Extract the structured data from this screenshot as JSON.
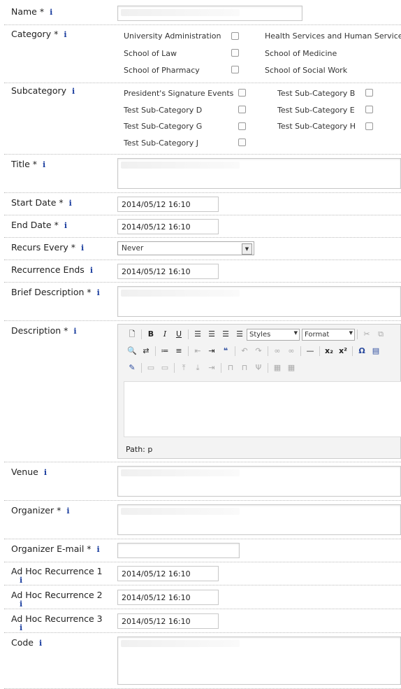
{
  "fields": {
    "name": {
      "label": "Name *",
      "info": "i"
    },
    "category": {
      "label": "Category *",
      "info": "i",
      "options": [
        "University Administration",
        "Health Services and Human Services",
        "School of Law",
        "School of Medicine",
        "School of Pharmacy",
        "School of Social Work"
      ]
    },
    "subcategory": {
      "label": "Subcategory",
      "info": "i",
      "options": [
        "President's Signature Events",
        "Test Sub-Category B",
        "Test Sub-Category D",
        "Test Sub-Category E",
        "Test Sub-Category G",
        "Test Sub-Category H",
        "Test Sub-Category J"
      ]
    },
    "title": {
      "label": "Title *",
      "info": "i"
    },
    "start_date": {
      "label": "Start Date *",
      "info": "i",
      "value": "2014/05/12 16:10"
    },
    "end_date": {
      "label": "End Date *",
      "info": "i",
      "value": "2014/05/12 16:10"
    },
    "recurs_every": {
      "label": "Recurs Every *",
      "info": "i",
      "value": "Never"
    },
    "recurrence_ends": {
      "label": "Recurrence Ends",
      "info": "i",
      "value": "2014/05/12 16:10"
    },
    "brief_description": {
      "label": "Brief Description *",
      "info": "i"
    },
    "description": {
      "label": "Description *",
      "info": "i",
      "styles_label": "Styles",
      "format_label": "Format",
      "path_label": "Path: p"
    },
    "venue": {
      "label": "Venue",
      "info": "i"
    },
    "organizer": {
      "label": "Organizer *",
      "info": "i"
    },
    "organizer_email": {
      "label": "Organizer E-mail *",
      "info": "i"
    },
    "adhoc1": {
      "label": "Ad Hoc Recurrence 1",
      "info": "i",
      "value": "2014/05/12 16:10"
    },
    "adhoc2": {
      "label": "Ad Hoc Recurrence 2",
      "info": "i",
      "value": "2014/05/12 16:10"
    },
    "adhoc3": {
      "label": "Ad Hoc Recurrence 3",
      "info": "i",
      "value": "2014/05/12 16:10"
    },
    "code": {
      "label": "Code",
      "info": "i"
    }
  },
  "colors": {
    "info_icon": "#1a3d9e",
    "border": "#c8c8c8"
  }
}
